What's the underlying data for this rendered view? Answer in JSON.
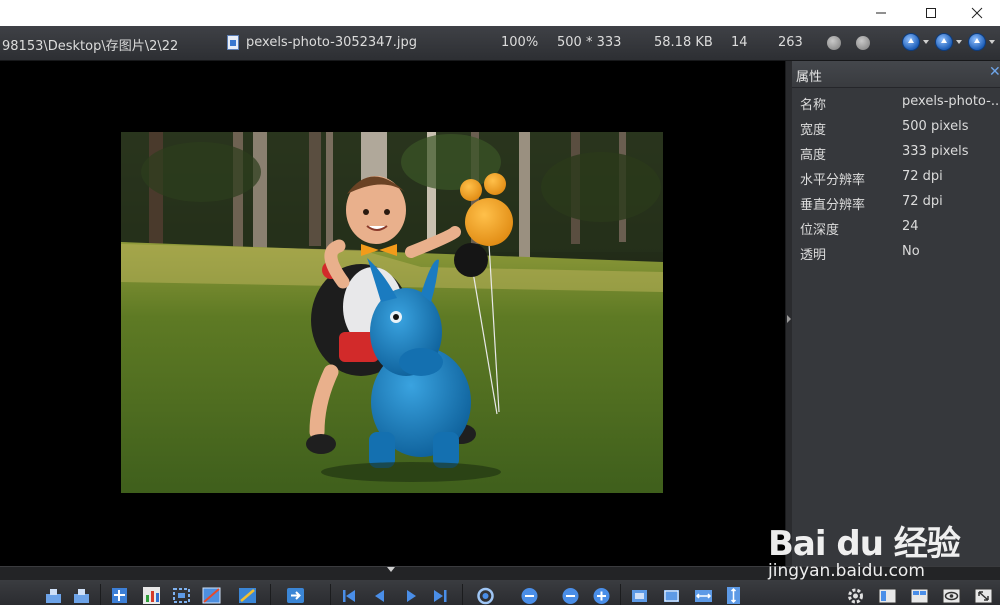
{
  "window": {
    "controls": [
      "minimize-icon",
      "maximize-icon",
      "close-icon"
    ]
  },
  "infobar": {
    "path": "98153\\Desktop\\存图片\\2\\22",
    "filename": "pexels-photo-3052347.jpg",
    "zoom": "100%",
    "dimensions": "500 * 333",
    "filesize": "58.18 KB",
    "index": "14",
    "total": "263"
  },
  "properties": {
    "title": "属性",
    "rows": [
      {
        "key": "名称",
        "value": "pexels-photo-..."
      },
      {
        "key": "宽度",
        "value": "500 pixels"
      },
      {
        "key": "高度",
        "value": "333 pixels"
      },
      {
        "key": "水平分辨率",
        "value": "72 dpi"
      },
      {
        "key": "垂直分辨率",
        "value": "72 dpi"
      },
      {
        "key": "位深度",
        "value": "24"
      },
      {
        "key": "透明",
        "value": "No"
      }
    ]
  },
  "watermark": {
    "logo": "Bai du 经验",
    "url": "jingyan.baidu.com"
  },
  "colors": {
    "background": "#000000",
    "panel": "#36383c",
    "infobar": "#36383c",
    "accent": "#1f5fb8"
  }
}
